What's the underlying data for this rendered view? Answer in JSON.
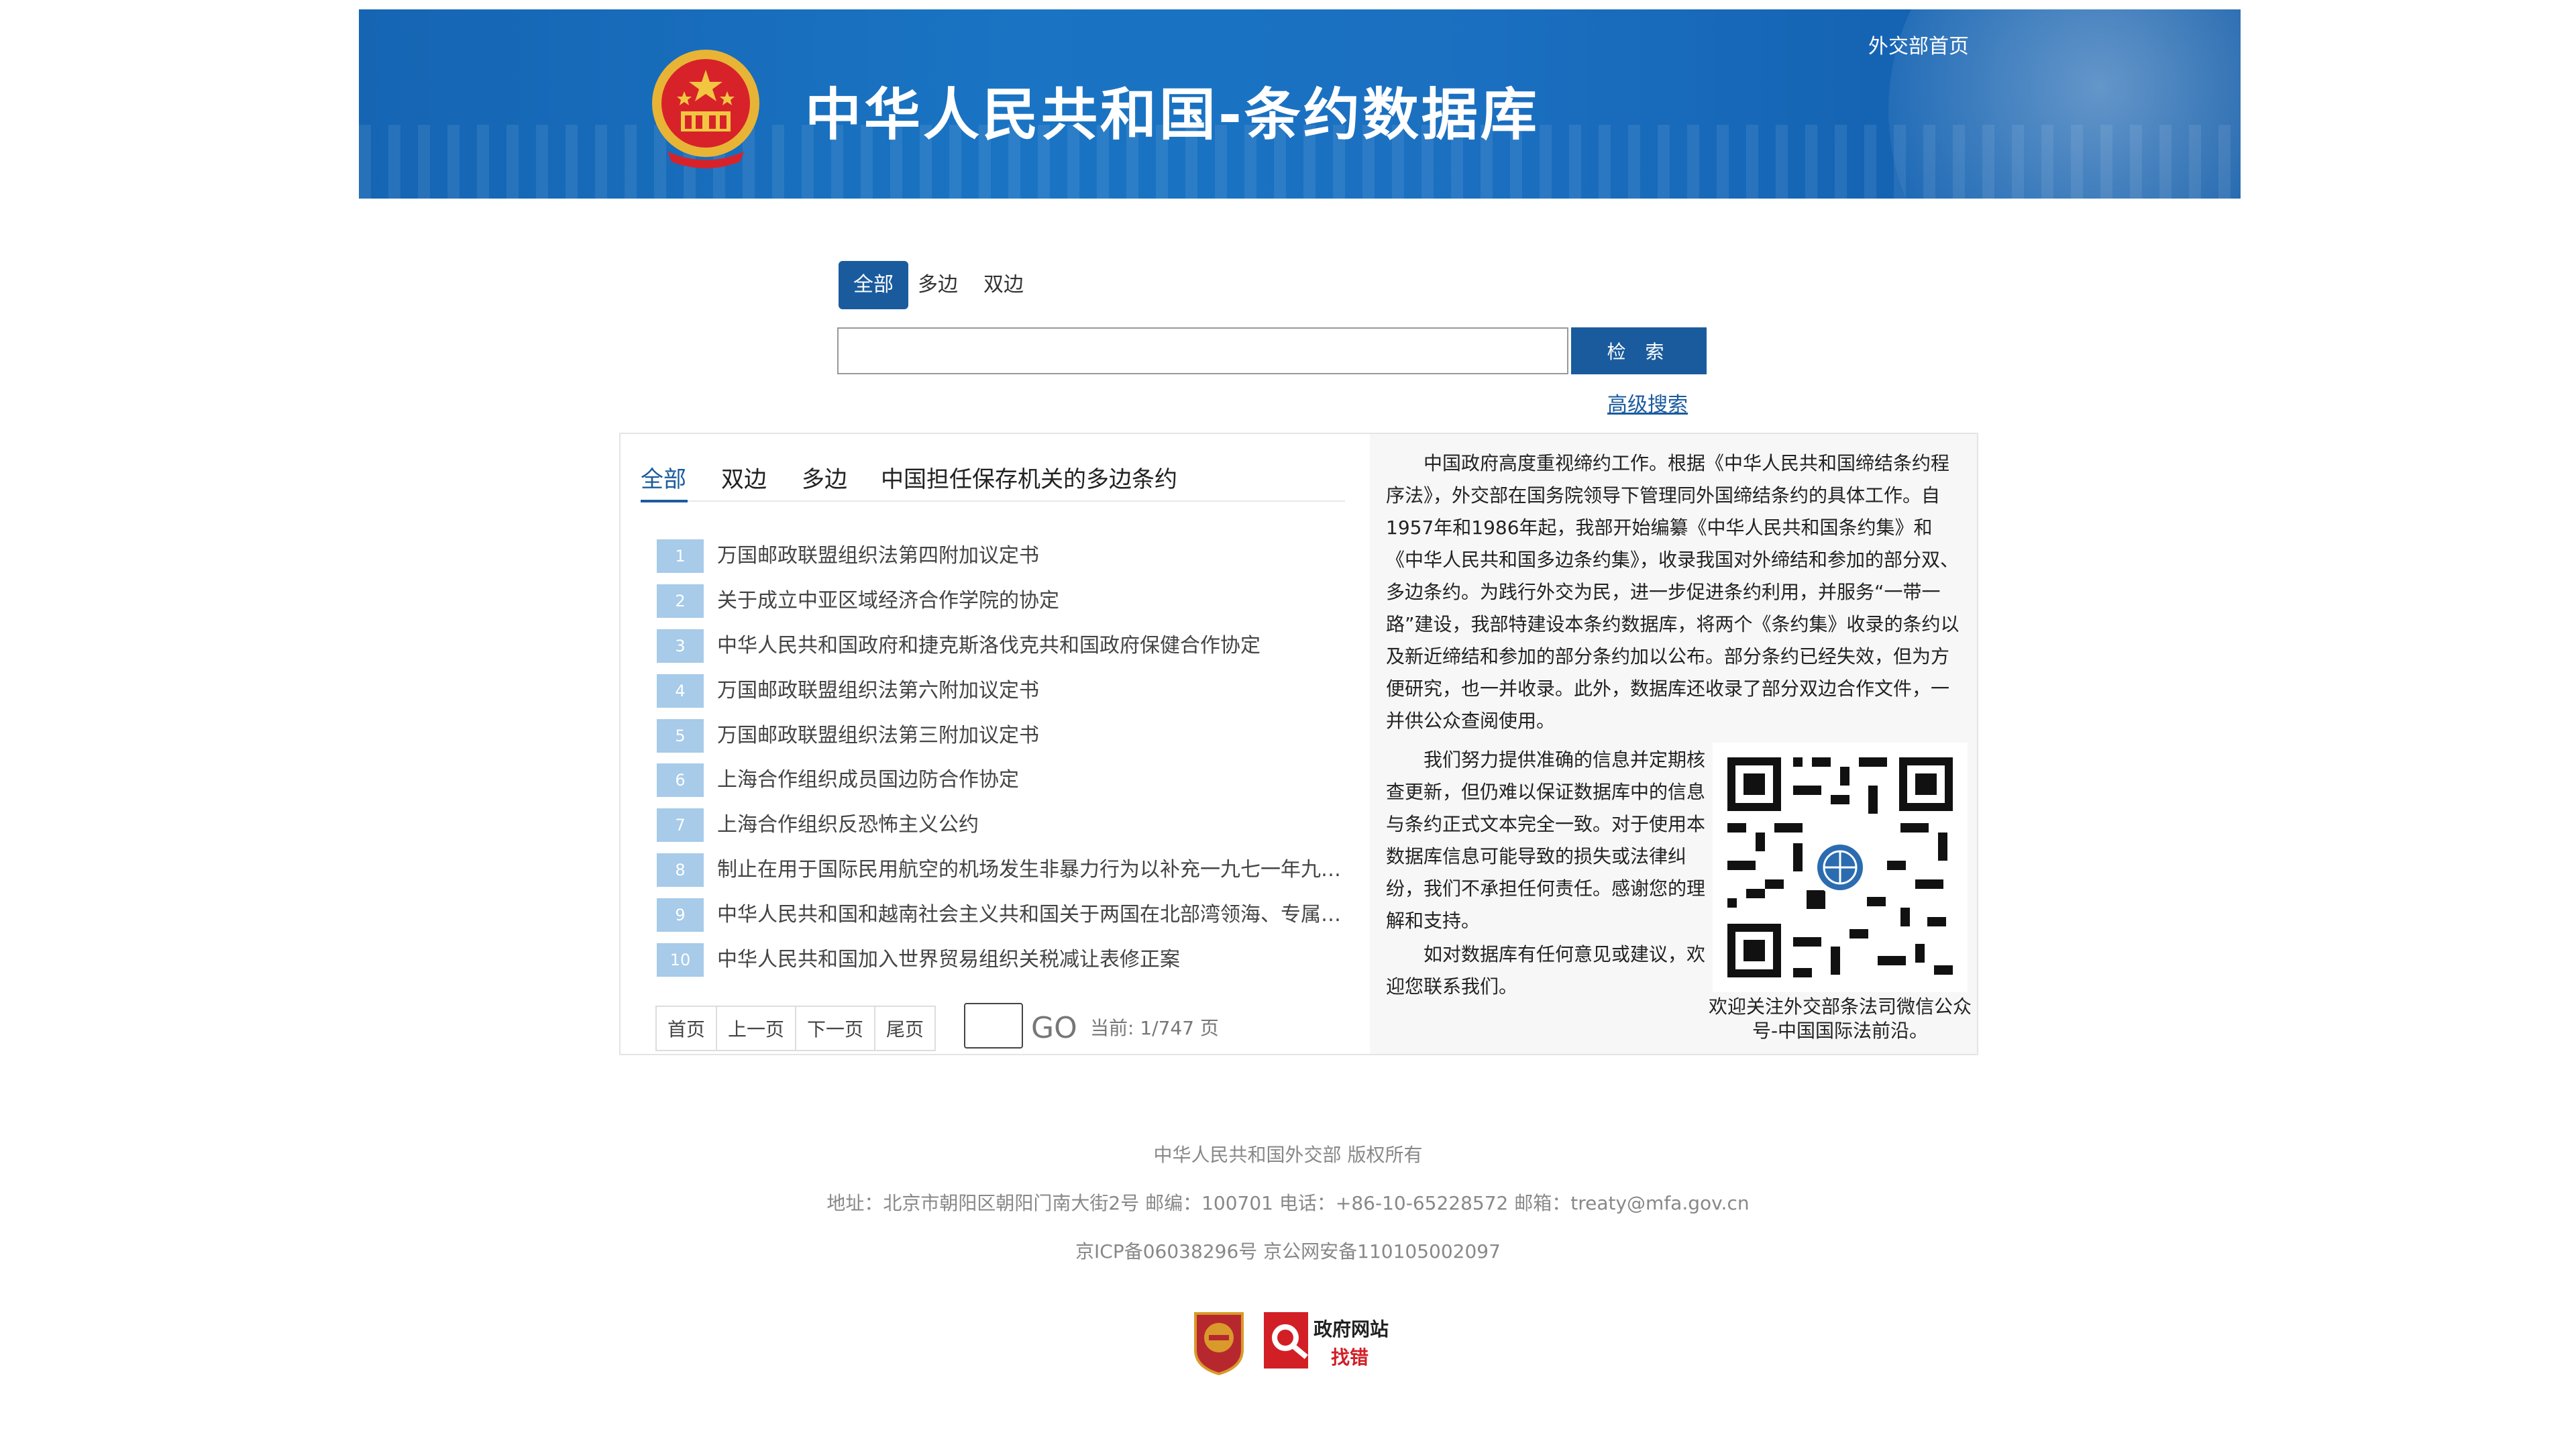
{
  "banner": {
    "title": "中华人民共和国-条约数据库",
    "home_link": "外交部首页"
  },
  "search": {
    "tabs": [
      "全部",
      "多边",
      "双边"
    ],
    "placeholder": "",
    "button": "检 索",
    "advanced": "高级搜索"
  },
  "list": {
    "tabs": [
      "全部",
      "双边",
      "多边",
      "中国担任保存机关的多边条约"
    ],
    "items": [
      {
        "num": "1",
        "title": "万国邮政联盟组织法第四附加议定书"
      },
      {
        "num": "2",
        "title": "关于成立中亚区域经济合作学院的协定"
      },
      {
        "num": "3",
        "title": "中华人民共和国政府和捷克斯洛伐克共和国政府保健合作协定"
      },
      {
        "num": "4",
        "title": "万国邮政联盟组织法第六附加议定书"
      },
      {
        "num": "5",
        "title": "万国邮政联盟组织法第三附加议定书"
      },
      {
        "num": "6",
        "title": "上海合作组织成员国边防合作协定"
      },
      {
        "num": "7",
        "title": "上海合作组织反恐怖主义公约"
      },
      {
        "num": "8",
        "title": "制止在用于国际民用航空的机场发生非暴力行为以补充一九七一年九月二..."
      },
      {
        "num": "9",
        "title": "中华人民共和国和越南社会主义共和国关于两国在北部湾领海、专属经济..."
      },
      {
        "num": "10",
        "title": "中华人民共和国加入世界贸易组织关税减让表修正案"
      }
    ],
    "pagination": {
      "first": "首页",
      "prev": "上一页",
      "next": "下一页",
      "last": "尾页",
      "go": "GO",
      "info": "当前: 1/747 页"
    }
  },
  "intro": {
    "p1": "中国政府高度重视缔约工作。根据《中华人民共和国缔结条约程序法》，外交部在国务院领导下管理同外国缔结条约的具体工作。自1957年和1986年起，我部开始编纂《中华人民共和国条约集》和《中华人民共和国多边条约集》，收录我国对外缔结和参加的部分双、多边条约。为践行外交为民，进一步促进条约利用，并服务“一带一路”建设，我部特建设本条约数据库，将两个《条约集》收录的条约以及新近缔结和参加的部分条约加以公布。部分条约已经失效，但为方便研究，也一并收录。此外，数据库还收录了部分双边合作文件，一并供公众查阅使用。",
    "p2": "我们努力提供准确的信息并定期核查更新，但仍难以保证数据库中的信息与条约正式文本完全一致。对于使用本数据库信息可能导致的损失或法律纠纷，我们不承担任何责任。感谢您的理解和支持。",
    "p3": "如对数据库有任何意见或建议，欢迎您联系我们。",
    "qr_caption": "欢迎关注外交部条法司微信公众号-中国国际法前沿。"
  },
  "footer": {
    "copyright": "中华人民共和国外交部 版权所有",
    "address": "地址：北京市朝阳区朝阳门南大街2号  邮编：100701  电话：+86-10-65228572  邮箱：treaty@mfa.gov.cn",
    "icp": "京ICP备06038296号    京公网安备110105002097",
    "badge_right_top": "政府网站",
    "badge_right_bottom": "找错"
  },
  "colors": {
    "accent": "#1a5b9e",
    "banner": "#1a6fc0",
    "number_badge": "#a7cbe9"
  }
}
